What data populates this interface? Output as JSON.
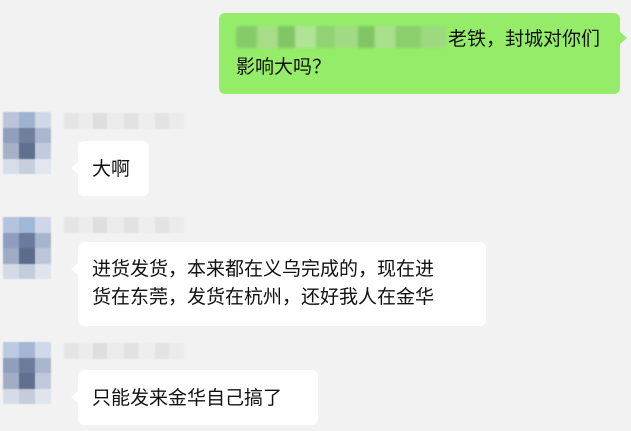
{
  "outgoing_message": {
    "line1_visible": "老铁，封城对你们",
    "line2": "影响大吗？"
  },
  "incoming_messages": [
    {
      "lines": [
        "大啊"
      ]
    },
    {
      "lines": [
        "进货发货，本来都在义乌完成的，现在进",
        "货在东莞，发货在杭州，还好我人在金华"
      ]
    },
    {
      "lines": [
        "只能发来金华自己搞了"
      ]
    }
  ],
  "colors": {
    "background": "#f2f2f2",
    "outgoing_bubble": "#95ec69",
    "incoming_bubble": "#ffffff"
  }
}
